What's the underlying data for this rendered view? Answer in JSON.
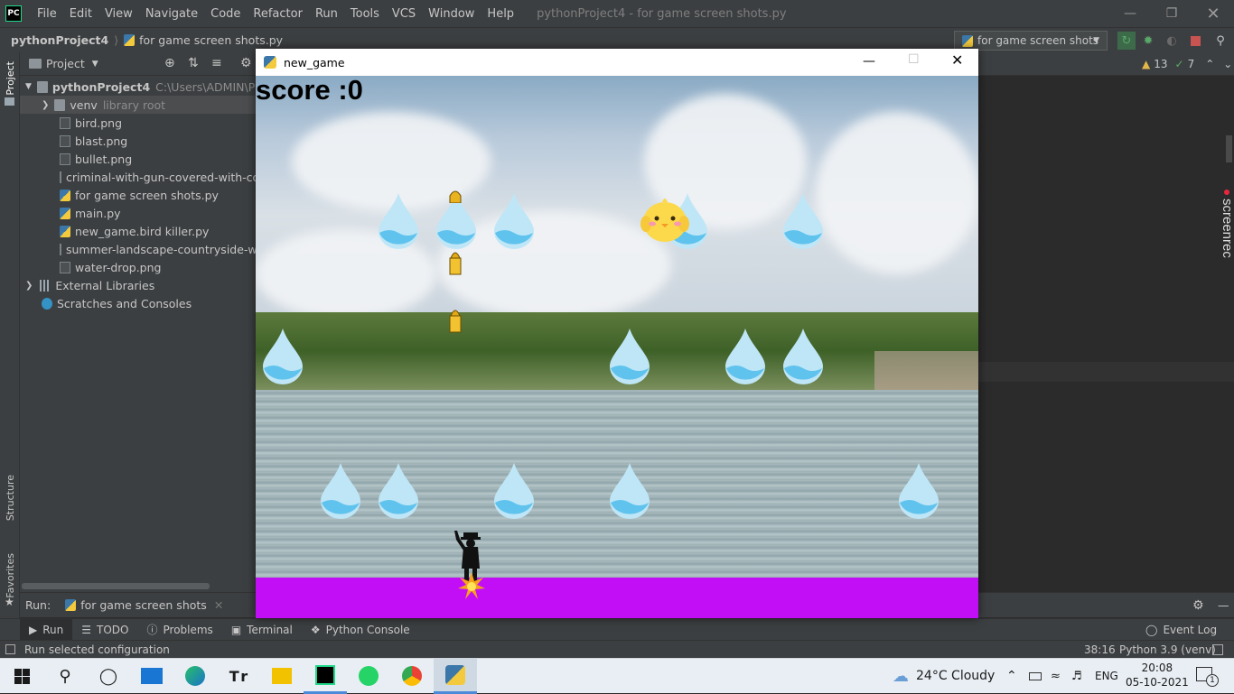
{
  "ide": {
    "logo": "PC",
    "menu": [
      "File",
      "Edit",
      "View",
      "Navigate",
      "Code",
      "Refactor",
      "Run",
      "Tools",
      "VCS",
      "Window",
      "Help"
    ],
    "window_title": "pythonProject4 - for game screen shots.py",
    "breadcrumb_project": "pythonProject4",
    "breadcrumb_file": "for game screen shots.py",
    "run_config": "for game screen shots",
    "inspections": {
      "warnings": "13",
      "ok": "7"
    }
  },
  "left_stripe": {
    "project": "Project",
    "structure": "Structure",
    "favorites": "Favorites"
  },
  "right_stripe": {
    "screenrec": "screenrec"
  },
  "project_panel": {
    "header": "Project",
    "root_name": "pythonProject4",
    "root_path": "C:\\Users\\ADMIN\\Pycha",
    "venv": "venv",
    "venv_tag": "library root",
    "files": [
      {
        "name": "bird.png",
        "icon": "image-file-icon"
      },
      {
        "name": "blast.png",
        "icon": "image-file-icon"
      },
      {
        "name": "bullet.png",
        "icon": "image-file-icon"
      },
      {
        "name": "criminal-with-gun-covered-with-coat",
        "icon": "image-file-icon"
      },
      {
        "name": "for game screen shots.py",
        "icon": "python-file-icon"
      },
      {
        "name": "main.py",
        "icon": "python-file-icon"
      },
      {
        "name": "new_game.bird killer.py",
        "icon": "python-file-icon"
      },
      {
        "name": "summer-landscape-countryside-with-",
        "icon": "image-file-icon"
      },
      {
        "name": "water-drop.png",
        "icon": "image-file-icon"
      }
    ],
    "external_libraries": "External Libraries",
    "scratches": "Scratches and Consoles"
  },
  "run_bar": {
    "label": "Run:",
    "tab": "for game screen shots"
  },
  "bottom_tabs": [
    "Run",
    "TODO",
    "Problems",
    "Terminal",
    "Python Console"
  ],
  "event_log": "Event Log",
  "status": {
    "message": "Run selected configuration",
    "position": "38:16",
    "interpreter": "Python 3.9 (venv)"
  },
  "game": {
    "window_title": "new_game",
    "score_text": "score :0",
    "ground_color": "#c20ef7"
  },
  "taskbar": {
    "weather": "24°C  Cloudy",
    "lang": "ENG",
    "time": "20:08",
    "date": "05-10-2021",
    "notification_count": "1"
  }
}
